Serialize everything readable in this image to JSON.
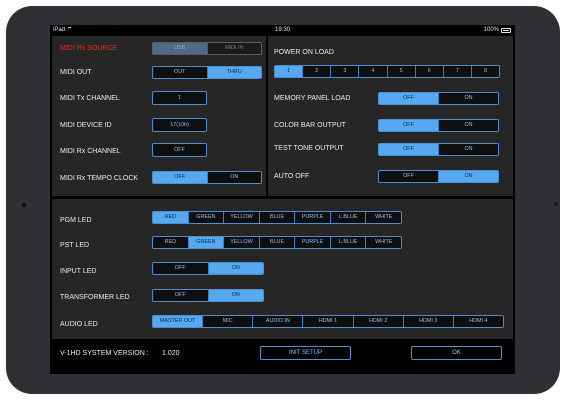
{
  "status_bar": {
    "device": "iPad",
    "time": "19:30",
    "battery": "100%"
  },
  "midi_settings": {
    "rx_source": {
      "label": "MIDI Rx SOURCE",
      "options": [
        "USB",
        "MIDI IN"
      ],
      "selected": 0
    },
    "midi_out": {
      "label": "MIDI OUT",
      "options": [
        "OUT",
        "THRU"
      ],
      "selected": 1
    },
    "tx_channel": {
      "label": "MIDI Tx CHANNEL",
      "value": "1"
    },
    "device_id": {
      "label": "MIDI DEVICE ID",
      "value": "17(10h)"
    },
    "rx_channel": {
      "label": "MIDI Rx CHANNEL",
      "value": "OFF"
    },
    "rx_tempo_clock": {
      "label": "MIDI Rx TEMPO CLOCK",
      "options": [
        "OFF",
        "ON"
      ],
      "selected": 0
    }
  },
  "power_settings": {
    "power_on_load": {
      "label": "POWER ON LOAD",
      "options": [
        "1",
        "2",
        "3",
        "4",
        "5",
        "6",
        "7",
        "8"
      ],
      "selected": 0
    },
    "memory_panel_load": {
      "label": "MEMORY PANEL LOAD",
      "options": [
        "OFF",
        "ON"
      ],
      "selected": 0
    },
    "color_bar_output": {
      "label": "COLOR BAR OUTPUT",
      "options": [
        "OFF",
        "ON"
      ],
      "selected": 0
    },
    "test_tone_output": {
      "label": "TEST TONE OUTPUT",
      "options": [
        "OFF",
        "ON"
      ],
      "selected": 0
    },
    "auto_off": {
      "label": "AUTO OFF",
      "options": [
        "OFF",
        "ON"
      ],
      "selected": 1
    }
  },
  "led_settings": {
    "pgm_led": {
      "label": "PGM LED",
      "options": [
        "RED",
        "GREEN",
        "YELLOW",
        "BLUE",
        "PURPLE",
        "L.BLUE",
        "WHITE"
      ],
      "selected": 0
    },
    "pst_led": {
      "label": "PST LED",
      "options": [
        "RED",
        "GREEN",
        "YELLOW",
        "BLUE",
        "PURPLE",
        "L.BLUE",
        "WHITE"
      ],
      "selected": 1
    },
    "input_led": {
      "label": "INPUT LED",
      "options": [
        "OFF",
        "ON"
      ],
      "selected": 1
    },
    "transformer_led": {
      "label": "TRANSFORMER LED",
      "options": [
        "OFF",
        "ON"
      ],
      "selected": 1
    },
    "audio_led": {
      "label": "AUDIO LED",
      "options": [
        "MASTER OUT",
        "MIC",
        "AUDIO IN",
        "HDMI 1",
        "HDMI 2",
        "HDMI 3",
        "HDMI 4"
      ],
      "selected": 0
    }
  },
  "footer": {
    "version_label": "V-1HD SYSTEM VERSION :",
    "version_value": "1.020",
    "init_setup": "INIT SETUP",
    "ok": "OK"
  },
  "colors": {
    "accent": "#56a8f0",
    "accent_border": "#4a8fd0",
    "warning": "#e4302a",
    "panel": "#262627",
    "background": "#000000"
  }
}
